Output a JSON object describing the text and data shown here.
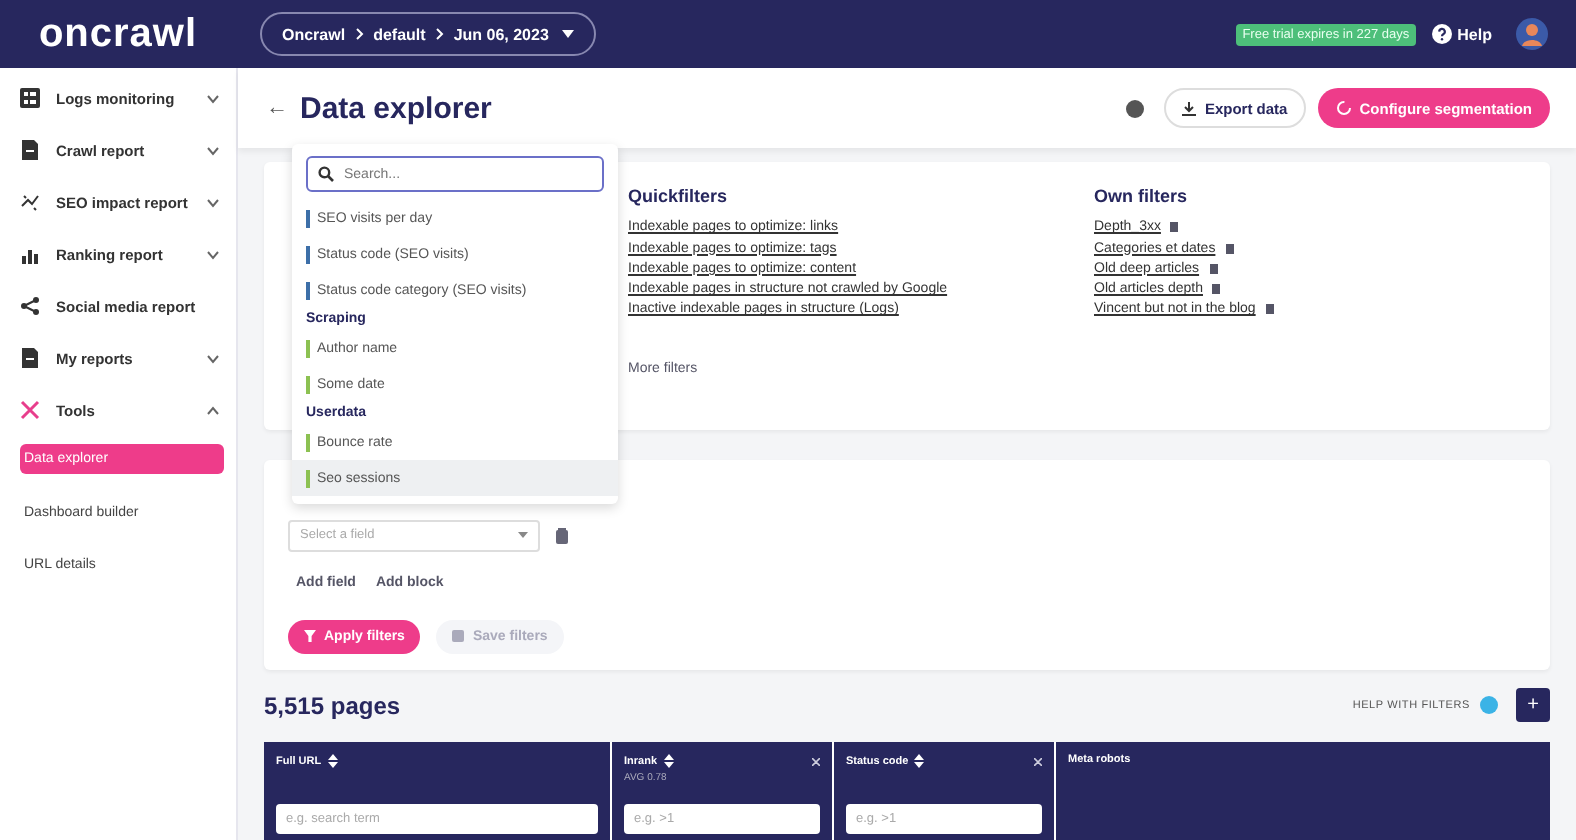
{
  "topbar": {
    "logo": "oncrawl",
    "breadcrumb": [
      "Oncrawl",
      "default",
      "Jun 06, 2023"
    ],
    "trial_badge": "Free trial expires in 227 days",
    "help": "Help"
  },
  "sidebar": {
    "items": [
      {
        "label": "Logs monitoring",
        "expanded": false
      },
      {
        "label": "Crawl report",
        "expanded": false
      },
      {
        "label": "SEO impact report",
        "expanded": false
      },
      {
        "label": "Ranking report",
        "expanded": false
      },
      {
        "label": "Social media report"
      },
      {
        "label": "My reports",
        "expanded": false
      },
      {
        "label": "Tools",
        "expanded": true,
        "children": [
          {
            "label": "Data explorer",
            "selected": true
          },
          {
            "label": "Dashboard builder",
            "selected": false
          },
          {
            "label": "URL details",
            "selected": false
          }
        ]
      }
    ]
  },
  "header": {
    "back": "←",
    "title": "Data explorer",
    "export": "Export data",
    "configure": "Configure segmentation"
  },
  "filters_card": {
    "quickfilters": {
      "title": "Quickfilters",
      "links": [
        "Indexable pages to optimize: links",
        "Indexable pages to optimize: tags",
        "Indexable pages to optimize: content",
        "Indexable pages in structure not crawled by Google",
        "Inactive indexable pages in structure (Logs)"
      ],
      "more": "More filters"
    },
    "own_filters": {
      "title": "Own filters",
      "links": [
        "Depth_3xx",
        "Categories et dates",
        "Old deep articles",
        "Old articles depth",
        "Vincent but not in the blog"
      ]
    }
  },
  "builder_card": {
    "field_placeholder": "Select a field",
    "add_field": "Add field",
    "add_block": "Add block",
    "apply": "Apply filters",
    "save": "Save filters",
    "save_disabled": true
  },
  "dropdown": {
    "search_placeholder": "Search...",
    "options": [
      {
        "kind": "option",
        "label": "SEO visits per day",
        "color": "#3d6fa8",
        "selected": false
      },
      {
        "kind": "option",
        "label": "Status code (SEO visits)",
        "color": "#3d6fa8",
        "selected": false
      },
      {
        "kind": "option",
        "label": "Status code category (SEO visits)",
        "color": "#3d6fa8",
        "selected": false
      },
      {
        "kind": "group",
        "label": "Scraping"
      },
      {
        "kind": "option",
        "label": "Author name",
        "color": "#8cc152",
        "selected": false
      },
      {
        "kind": "option",
        "label": "Some date",
        "color": "#8cc152",
        "selected": false
      },
      {
        "kind": "group",
        "label": "Userdata"
      },
      {
        "kind": "option",
        "label": "Bounce rate",
        "color": "#8cc152",
        "selected": false
      },
      {
        "kind": "option",
        "label": "Seo sessions",
        "color": "#8cc152",
        "selected": true
      }
    ]
  },
  "results": {
    "count": "5,515 pages",
    "help_filters": "HELP WITH FILTERS",
    "add": "+"
  },
  "table": {
    "columns": [
      {
        "label": "Full URL",
        "sortable": true,
        "removable": false,
        "placeholder": "e.g. search term"
      },
      {
        "label": "Inrank",
        "sortable": true,
        "removable": true,
        "sub": "AVG 0.78",
        "placeholder": "e.g. >1"
      },
      {
        "label": "Status code",
        "sortable": true,
        "removable": true,
        "placeholder": "e.g. >1"
      },
      {
        "label": "Meta robots",
        "sortable": false,
        "removable": false
      }
    ]
  }
}
